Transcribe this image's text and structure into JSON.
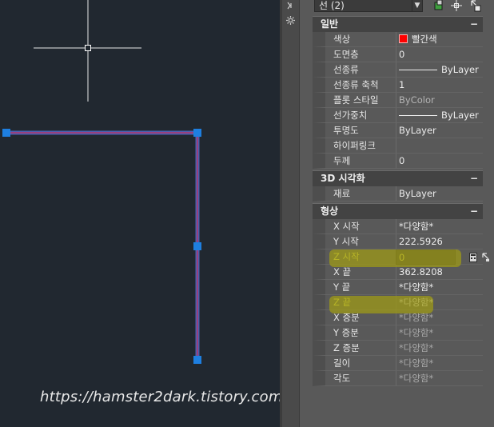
{
  "canvas": {
    "watermark": "https://hamster2dark.tistory.com",
    "crosshair_icon": "crosshair-cursor-icon",
    "grip_color": "#1e7fe0",
    "line_color": "#7a4fa0"
  },
  "toolstrip": {
    "pin_icon": "pin-icon",
    "settings_icon": "settings-icon"
  },
  "selector": {
    "value": "선 (2)",
    "arrow_icon": "chevron-down-icon"
  },
  "toolbar": {
    "toggle_pickadd_icon": "toggle-pickadd-icon",
    "select_objects_icon": "select-objects-icon",
    "quick_select_icon": "quick-select-icon"
  },
  "sections": {
    "general": {
      "title": "일반",
      "toggle": "−",
      "rows": [
        {
          "name": "색상",
          "value": "빨간색"
        },
        {
          "name": "도면층",
          "value": "0"
        },
        {
          "name": "선종류",
          "value": "ByLayer"
        },
        {
          "name": "선종류 축척",
          "value": "1"
        },
        {
          "name": "플롯 스타일",
          "value": "ByColor"
        },
        {
          "name": "선가중치",
          "value": "ByLayer"
        },
        {
          "name": "투명도",
          "value": "ByLayer"
        },
        {
          "name": "하이퍼링크",
          "value": ""
        },
        {
          "name": "두께",
          "value": "0"
        }
      ]
    },
    "visual3d": {
      "title": "3D 시각화",
      "toggle": "−",
      "rows": [
        {
          "name": "재료",
          "value": "ByLayer"
        }
      ]
    },
    "geometry": {
      "title": "형상",
      "toggle": "−",
      "rows": [
        {
          "name": "X 시작",
          "value": "*다양함*"
        },
        {
          "name": "Y 시작",
          "value": "222.5926"
        },
        {
          "name": "Z 시작",
          "value": "0"
        },
        {
          "name": "X 끝",
          "value": "362.8208"
        },
        {
          "name": "Y 끝",
          "value": "*다양함*"
        },
        {
          "name": "Z 끝",
          "value": "*다양함*"
        },
        {
          "name": "X 증분",
          "value": "*다양함*"
        },
        {
          "name": "Y 증분",
          "value": "*다양함*"
        },
        {
          "name": "Z 증분",
          "value": "*다양함*"
        },
        {
          "name": "길이",
          "value": "*다양함*"
        },
        {
          "name": "각도",
          "value": "*다양함*"
        }
      ],
      "calculator_icon": "calculator-icon",
      "pick_point_icon": "pick-point-icon",
      "highlight_color": "#9e9a17"
    }
  }
}
